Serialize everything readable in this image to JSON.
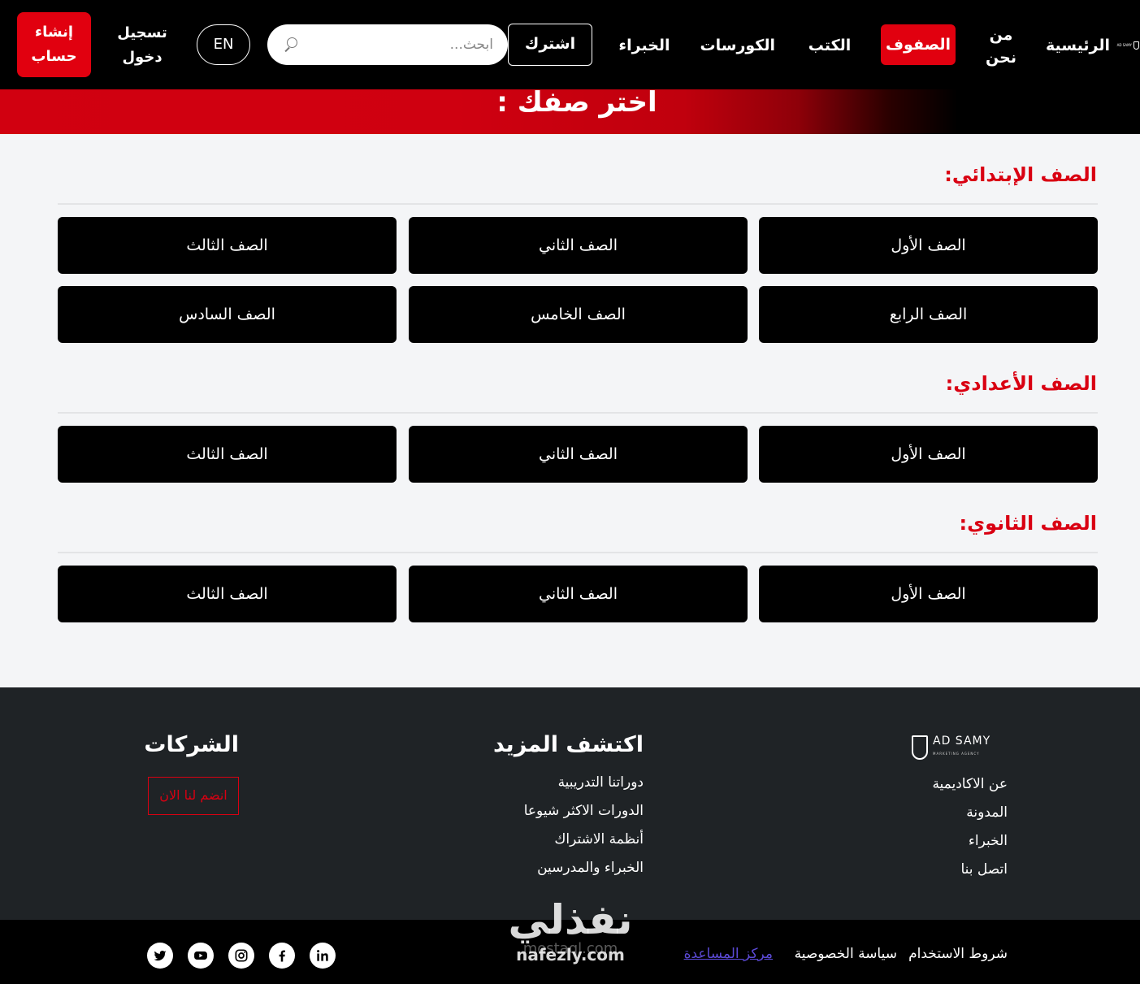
{
  "navbar": {
    "logo_text": "AD SAMY",
    "items": {
      "home": "الرئيسية",
      "about": "من نحن",
      "grades": "الصفوف",
      "books": "الكتب",
      "courses": "الكورسات",
      "experts": "الخبراء"
    },
    "subscribe_label": "اشترك",
    "search_placeholder": "ابحث...",
    "lang_label": "EN",
    "login_label": "تسجيل دخول",
    "signup_label": "إنشاء حساب",
    "colors": {
      "accent": "#e1000f",
      "bar": "#000000"
    }
  },
  "hero": {
    "title": "اختر صفك :"
  },
  "sections": {
    "primary": {
      "title": "الصف الإبتدائي:",
      "grades": [
        "الصف الأول",
        "الصف الثاني",
        "الصف الثالث",
        "الصف الرابع",
        "الصف الخامس",
        "الصف السادس"
      ]
    },
    "preparatory": {
      "title": "الصف الأعدادي:",
      "grades": [
        "الصف الأول",
        "الصف الثاني",
        "الصف الثالث"
      ]
    },
    "secondary": {
      "title": "الصف الثانوي:",
      "grades": [
        "الصف الأول",
        "الصف الثاني",
        "الصف الثالث"
      ]
    }
  },
  "footer": {
    "logo_text": "AD SAMY",
    "logo_subtext": "MARKETING AGENCY",
    "about_links": [
      "عن الاكاديمية",
      "المدونة",
      "الخبراء",
      "اتصل بنا"
    ],
    "explore": {
      "heading": "اكتشف المزيد",
      "links": [
        "دوراتنا التدريبية",
        "الدورات الاكثر شيوعا",
        "أنظمة الاشتراك",
        "الخبراء والمدرسين"
      ]
    },
    "companies": {
      "heading": "الشركات",
      "join_label": "انضم لنا الان"
    },
    "bottom": {
      "terms": "شروط الاستخدام",
      "privacy": "سياسة الخصوصية",
      "help": "مركز المساعدة"
    },
    "social_icons": [
      "linkedin-icon",
      "facebook-icon",
      "instagram-icon",
      "youtube-icon",
      "twitter-icon"
    ]
  },
  "watermark": {
    "main": "نفذلي",
    "sub": "nafezly.com",
    "ghost": "mostaql.com"
  }
}
